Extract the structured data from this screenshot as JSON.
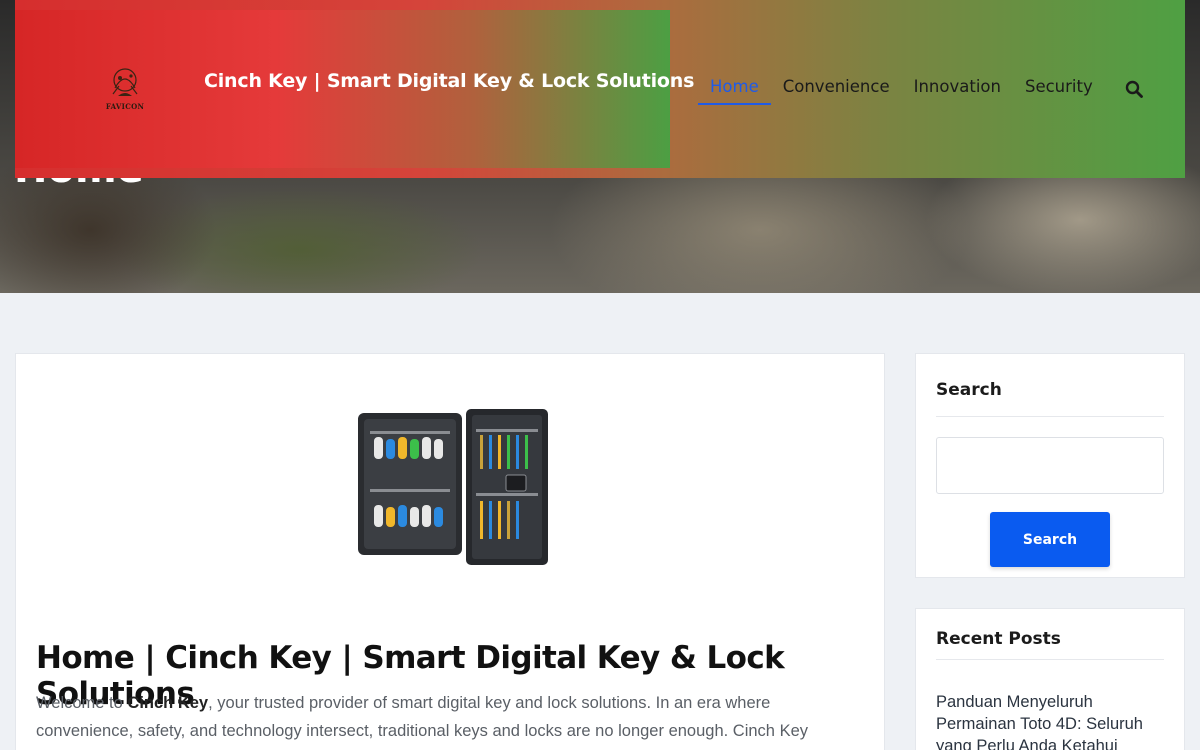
{
  "hero": {
    "page_title": "Home"
  },
  "header": {
    "logo_text": "FAVICON",
    "site_title": "Cinch Key | Smart Digital Key & Lock Solutions",
    "nav": [
      {
        "label": "Home",
        "active": true
      },
      {
        "label": "Convenience",
        "active": false
      },
      {
        "label": "Innovation",
        "active": false
      },
      {
        "label": "Security",
        "active": false
      }
    ],
    "search_icon": "search-icon"
  },
  "article": {
    "image_alt": "key-cabinet-image",
    "title": "Home | Cinch Key | Smart Digital Key & Lock Solutions",
    "intro_prefix": "Welcome to ",
    "intro_brand": "Cinch Key",
    "intro_rest": ", your trusted provider of smart digital key and lock solutions. In an era where convenience, safety, and technology intersect, traditional keys and locks are no longer enough. Cinch Key"
  },
  "sidebar": {
    "search": {
      "title": "Search",
      "input_value": "",
      "button_label": "Search"
    },
    "recent_posts": {
      "title": "Recent Posts",
      "items": [
        "Panduan Menyeluruh Permainan Toto 4D: Seluruh yang Perlu Anda Ketahui"
      ]
    }
  },
  "colors": {
    "accent_blue": "#0a5bf0",
    "nav_active": "#1f5be8",
    "header_red": "#d62e2e",
    "header_green": "#4fa043"
  }
}
